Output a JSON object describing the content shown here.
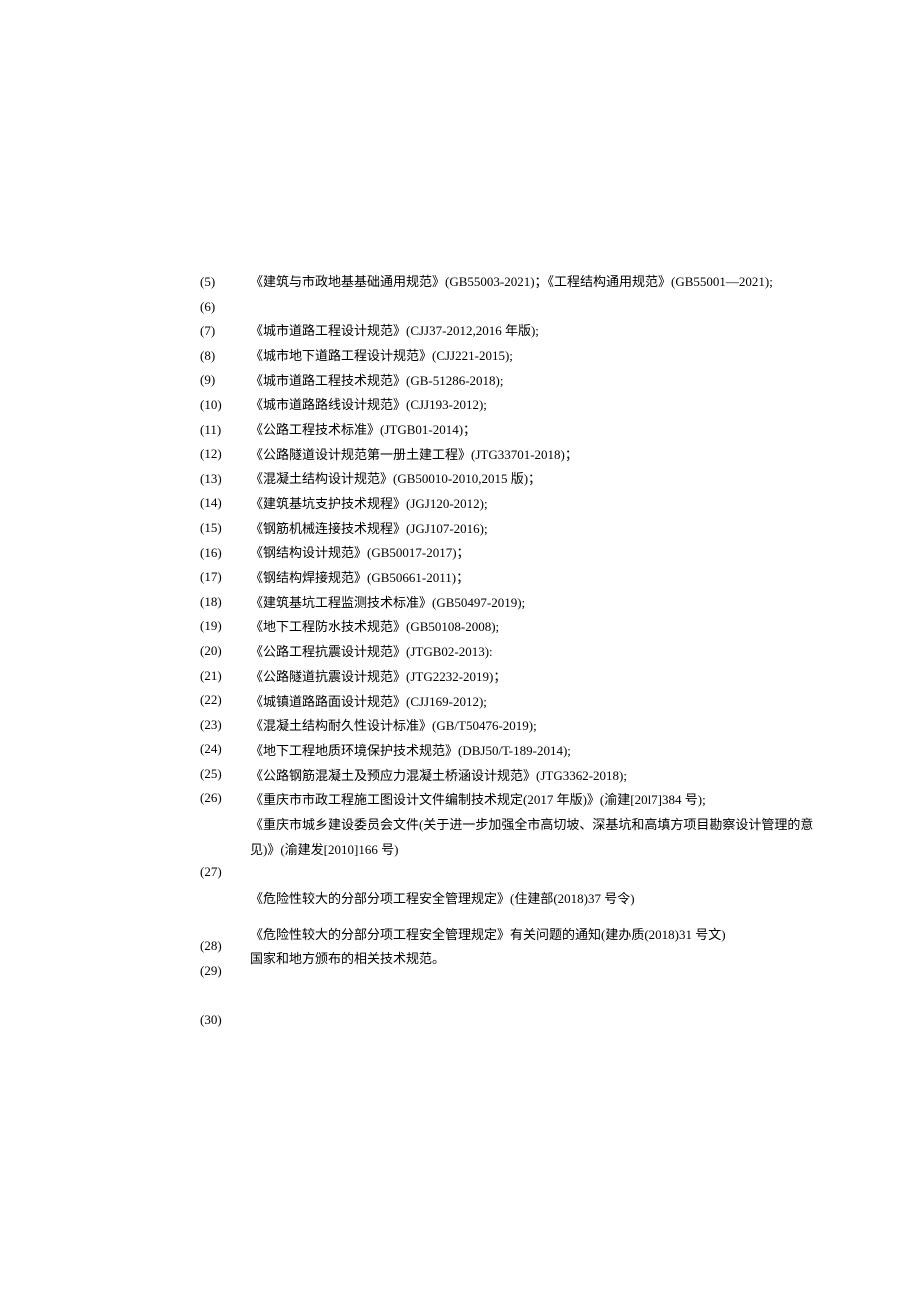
{
  "numbers": [
    "(5)",
    "(6)",
    "(7)",
    "(8)",
    "(9)",
    "(10)",
    "(11)",
    "(12)",
    "(13)",
    "(14)",
    "(15)",
    "(16)",
    "(17)",
    "(18)",
    "(19)",
    "(20)",
    "(21)",
    "(22)",
    "(23)",
    "(24)",
    "(25)",
    "(26)",
    "",
    "",
    "(27)",
    "",
    "",
    "(28)",
    "(29)",
    "",
    "(30)"
  ],
  "texts": [
    "《建筑与市政地基基础通用规范》(GB55003-2021)；《工程结构通用规范》(GB55001—2021);",
    "《城市道路工程设计规范》(CJJ37-2012,2016 年版);",
    "《城市地下道路工程设计规范》(CJJ221-2015);",
    "《城市道路工程技术规范》(GB-51286-2018);",
    "《城市道路路线设计规范》(CJJ193-2012);",
    "《公路工程技术标准》(JTGB01-2014)；",
    "《公路隧道设计规范第一册土建工程》(JTG33701-2018)；",
    "《混凝土结构设计规范》(GB50010-2010,2015 版)；",
    "《建筑基坑支护技术规程》(JGJ120-2012);",
    "《钢筋机械连接技术规程》(JGJ107-2016);",
    "《钢结构设计规范》(GB50017-2017)；",
    "《钢结构焊接规范》(GB50661-2011)；",
    "《建筑基坑工程监测技术标准》(GB50497-2019);",
    "《地下工程防水技术规范》(GB50108-2008);",
    "《公路工程抗震设计规范》(JTGB02-2013):",
    "《公路隧道抗震设计规范》(JTG2232-2019)；",
    "《城镇道路路面设计规范》(CJJ169-2012);",
    "《混凝土结构耐久性设计标准》(GB/T50476-2019);",
    "《地下工程地质环境保护技术规范》(DBJ50/T-189-2014);",
    "《公路钢筋混凝土及预应力混凝土桥涵设计规范》(JTG3362-2018);",
    "《重庆市市政工程施工图设计文件编制技术规定(2017 年版)》(渝建[20l7]384 号);",
    "《重庆市城乡建设委员会文件(关于进一步加强全市高切坡、深基坑和高填方项目勘察设计管理的意见)》(渝建发[2010]166 号)",
    "《危险性较大的分部分项工程安全管理规定》(住建部(2018)37 号令)",
    "《危险性较大的分部分项工程安全管理规定》有关问题的通知(建办质(2018)31 号文)",
    "国家和地方颁布的相关技术规范。"
  ]
}
